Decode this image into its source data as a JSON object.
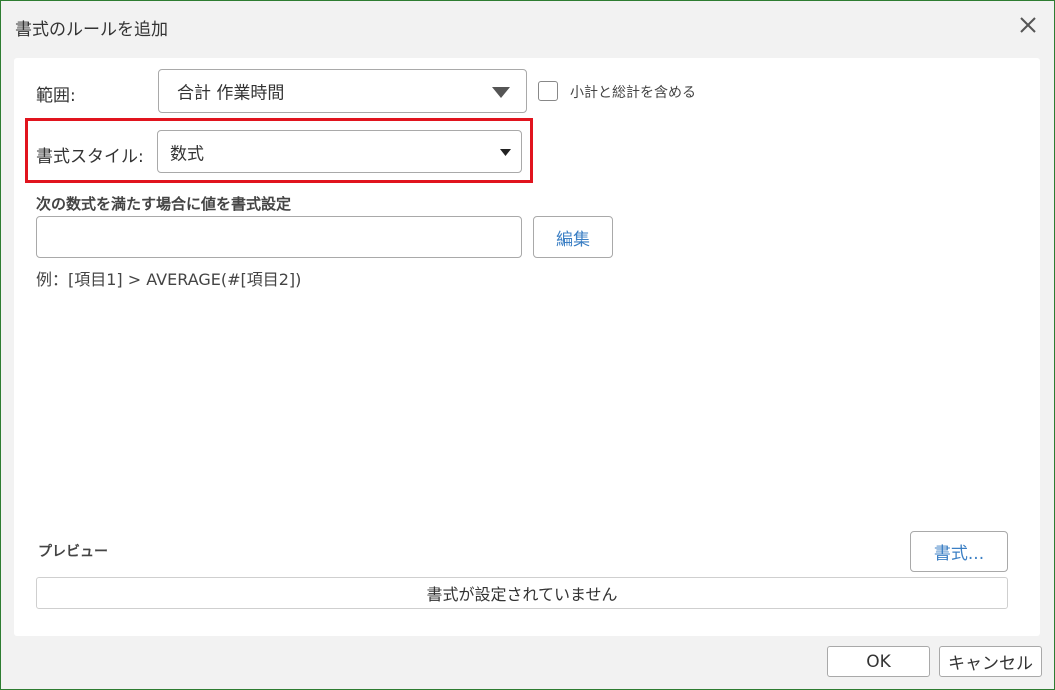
{
  "dialog": {
    "title": "書式のルールを追加",
    "close_icon": "close-icon"
  },
  "range": {
    "label": "範囲:",
    "selected": "合計 作業時間",
    "include_subtotals_label": "小計と総計を含める",
    "include_subtotals_checked": false
  },
  "format_style": {
    "label": "書式スタイル:",
    "selected": "数式"
  },
  "formula": {
    "section_title": "次の数式を満たす場合に値を書式設定",
    "value": "",
    "edit_label": "編集",
    "example": "例：[項目1] > AVERAGE(#[項目2])"
  },
  "preview": {
    "title": "プレビュー",
    "format_button": "書式...",
    "status_text": "書式が設定されていません"
  },
  "footer": {
    "ok_label": "OK",
    "cancel_label": "キャンセル"
  },
  "colors": {
    "highlight": "#e1141e",
    "link": "#3b7fc4",
    "border_green": "#2e7d32"
  }
}
